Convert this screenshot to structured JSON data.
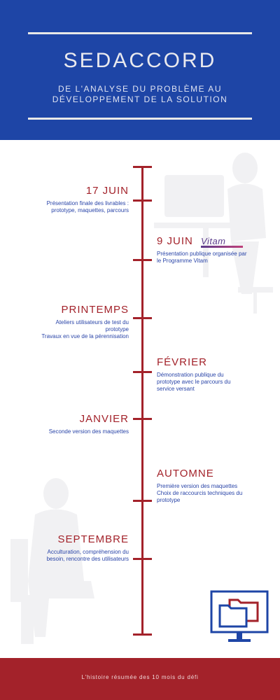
{
  "header": {
    "title": "SEDACCORD",
    "subtitle_line1": "DE L'ANALYSE DU PROBLÈME AU",
    "subtitle_line2": "DÉVELOPPEMENT DE LA SOLUTION"
  },
  "timeline": [
    {
      "title": "17 JUIN",
      "desc": [
        "Présentation finale des livrables :",
        "prototype, maquettes, parcours"
      ]
    },
    {
      "title": "9 JUIN",
      "logo_text": "Vitam",
      "desc": [
        "Présentation publique organisée par",
        "le Programme Vitam"
      ]
    },
    {
      "title": "PRINTEMPS",
      "desc": [
        "Ateliers utilisateurs de test du",
        "prototype",
        "Travaux en vue de la pérennisation"
      ]
    },
    {
      "title": "FÉVRIER",
      "desc": [
        "Démonstration publique du",
        "prototype avec le parcours du",
        "service versant"
      ]
    },
    {
      "title": "JANVIER",
      "desc": [
        "Seconde version des maquettes"
      ]
    },
    {
      "title": "AUTOMNE",
      "desc": [
        "Première version des maquettes",
        "Choix de raccourcis techniques du",
        "prototype"
      ]
    },
    {
      "title": "SEPTEMBRE",
      "desc": [
        "Acculturation, compréhension du",
        "besoin, rencontre des utilisateurs"
      ]
    }
  ],
  "footer": {
    "text": "L'histoire résumée des 10 mois du défi"
  },
  "colors": {
    "header_blue": "#1e45a6",
    "accent_red": "#a3222a",
    "text_blue": "#2a45a8"
  },
  "icons": [
    "computer-folders-icon",
    "vitam-logo"
  ]
}
